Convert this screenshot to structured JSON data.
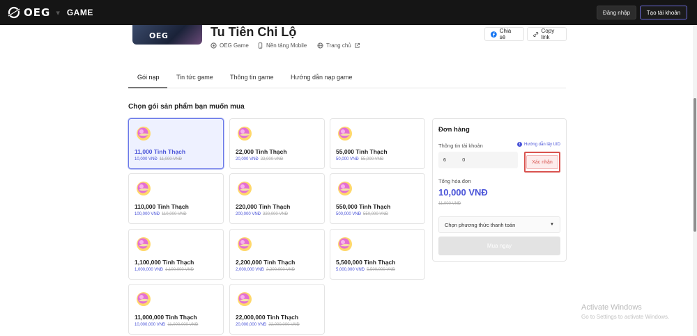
{
  "nav": {
    "brand": "OEG",
    "separator": "▾",
    "section": "GAME",
    "login_label": "Đăng nhập",
    "register_label": "Tạo tài khoản"
  },
  "game": {
    "image_logo": "OEG",
    "title": "Tu Tiên Chi Lộ",
    "publisher": "OEG Game",
    "platform": "Nền tảng Mobile",
    "homepage": "Trang chủ",
    "share_label": "Chia sẻ",
    "copy_label": "Copy link"
  },
  "tabs": [
    {
      "label": "Gói nạp"
    },
    {
      "label": "Tin tức game"
    },
    {
      "label": "Thông tin game"
    },
    {
      "label": "Hướng dẫn nạp game"
    }
  ],
  "section_title": "Chọn gói sản phẩm bạn muốn mua",
  "packages": [
    {
      "name": "11,000 Tinh Thạch",
      "price": "10,000 VNĐ",
      "old": "11,000 VNĐ"
    },
    {
      "name": "22,000 Tinh Thạch",
      "price": "20,000 VNĐ",
      "old": "22,000 VNĐ"
    },
    {
      "name": "55,000 Tinh Thạch",
      "price": "50,000 VNĐ",
      "old": "55,000 VNĐ"
    },
    {
      "name": "110,000 Tinh Thạch",
      "price": "100,000 VNĐ",
      "old": "110,000 VNĐ"
    },
    {
      "name": "220,000 Tinh Thạch",
      "price": "200,000 VNĐ",
      "old": "220,000 VNĐ"
    },
    {
      "name": "550,000 Tinh Thạch",
      "price": "500,000 VNĐ",
      "old": "550,000 VNĐ"
    },
    {
      "name": "1,100,000 Tinh Thạch",
      "price": "1,000,000 VNĐ",
      "old": "1,100,000 VNĐ"
    },
    {
      "name": "2,200,000 Tinh Thạch",
      "price": "2,000,000 VNĐ",
      "old": "2,200,000 VNĐ"
    },
    {
      "name": "5,500,000 Tinh Thạch",
      "price": "5,000,000 VNĐ",
      "old": "5,500,000 VNĐ"
    },
    {
      "name": "11,000,000 Tinh Thạch",
      "price": "10,000,000 VNĐ",
      "old": "11,000,000 VNĐ"
    },
    {
      "name": "22,000,000 Tinh Thạch",
      "price": "20,000,000 VNĐ",
      "old": "22,000,000 VNĐ"
    }
  ],
  "order": {
    "title": "Đơn hàng",
    "account_label": "Thông tin tài khoản",
    "uid_help": "Hướng dẫn lấy UID",
    "uid_value": "6            0",
    "confirm_label": "Xác nhận",
    "total_label": "Tổng hóa đơn",
    "total_value": "10,000 VNĐ",
    "total_old": "11,000 VNĐ",
    "payment_placeholder": "Chọn phương thức thanh toán",
    "buy_label": "Mua ngay"
  },
  "watermark": {
    "title": "Activate Windows",
    "subtitle": "Go to Settings to activate Windows."
  },
  "colors": {
    "accent": "#4a54d8",
    "topbar": "#151515",
    "confirm_highlight": "#d9534f"
  }
}
